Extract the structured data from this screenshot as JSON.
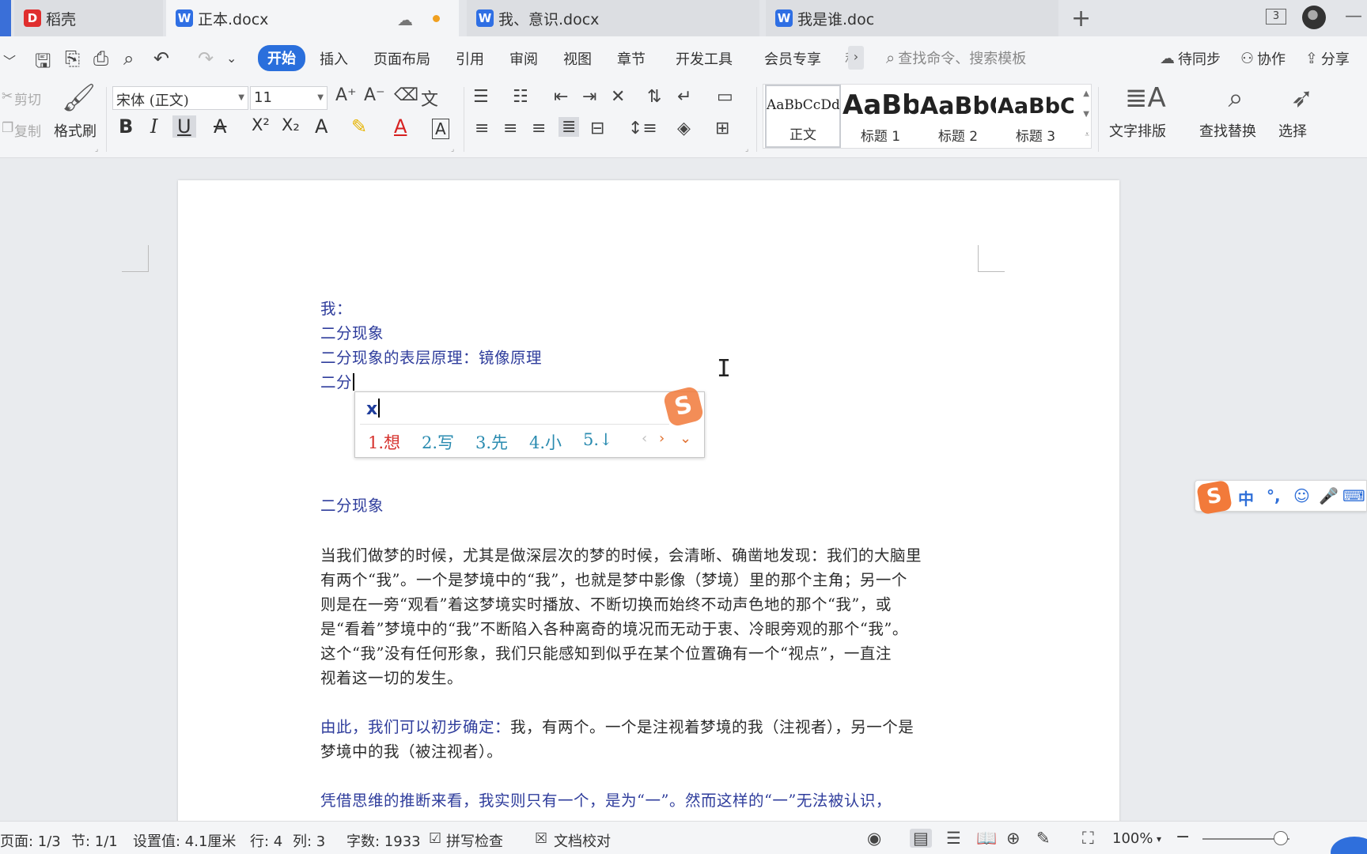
{
  "tabs": [
    {
      "label": "稻壳",
      "icon": "docer-icon",
      "active": false
    },
    {
      "label": "正本.docx",
      "icon": "word-doc-icon",
      "active": true,
      "unsaved": true
    },
    {
      "label": "我、意识.docx",
      "icon": "word-doc-icon",
      "active": false
    },
    {
      "label": "我是谁.doc",
      "icon": "word-doc-icon",
      "active": false
    }
  ],
  "window": {
    "count": "3"
  },
  "menu": {
    "items": [
      "开始",
      "插入",
      "页面布局",
      "引用",
      "审阅",
      "视图",
      "章节",
      "开发工具",
      "会员专享",
      "私"
    ],
    "active": "开始",
    "search_placeholder": "查找命令、搜索模板",
    "sync": "待同步",
    "collab": "协作",
    "share": "分享"
  },
  "ribbon": {
    "cut": "剪切",
    "copy": "复制",
    "format_painter": "格式刷",
    "font_name": "宋体 (正文)",
    "font_size": "11",
    "styles": [
      {
        "preview": "AaBbCcDd",
        "name": "正文"
      },
      {
        "preview": "AaBb",
        "name": "标题 1"
      },
      {
        "preview": "AaBbC",
        "name": "标题 2"
      },
      {
        "preview": "AaBbCc",
        "name": "标题 3"
      }
    ],
    "text_layout": "文字排版",
    "find_replace": "查找替换",
    "select": "选择"
  },
  "document": {
    "lines": [
      {
        "text": "我：",
        "blue": true
      },
      {
        "text": "二分现象",
        "blue": true
      },
      {
        "text": "二分现象的表层原理：镜像原理",
        "blue": true
      },
      {
        "text": "二分",
        "blue": true
      },
      {
        "text": "二分现象",
        "blue": true
      },
      {
        "text": "当我们做梦的时候，尤其是做深层次的梦的时候，会清晰、确凿地发现：我们的大脑里",
        "blue": false
      },
      {
        "text": "有两个“我”。一个是梦境中的“我”，也就是梦中影像（梦境）里的那个主角；另一个",
        "blue": false
      },
      {
        "text": "则是在一旁“观看”着这梦境实时播放、不断切换而始终不动声色地的那个“我”，或",
        "blue": false
      },
      {
        "text": "是“看着”梦境中的“我”不断陷入各种离奇的境况而无动于衷、冷眼旁观的那个“我”。",
        "blue": false
      },
      {
        "text": "这个“我”没有任何形象，我们只能感知到似乎在某个位置确有一个“视点”，一直注",
        "blue": false
      },
      {
        "text": "视着这一切的发生。",
        "blue": false
      },
      {
        "text": "由此，我们可以初步确定：",
        "blue": true,
        "rest": "我，有两个。一个是注视着梦境的我（注视者），另一个是"
      },
      {
        "text": "梦境中的我（被注视者）。",
        "blue": false
      },
      {
        "text": "凭借思维的推断来看，我实则只有一个，是为“一”。然而这样的“一”无法被认识，",
        "blue": true
      }
    ]
  },
  "ime": {
    "input": "x",
    "candidates": [
      "1.想",
      "2.写",
      "3.先",
      "4.小",
      "5.↓"
    ],
    "bar_lang": "中",
    "bar_punct": "°,"
  },
  "status": {
    "page": "页面: 1/3",
    "section": "节: 1/1",
    "setting": "设置值: 4.1厘米",
    "row": "行: 4",
    "col": "列: 3",
    "wordcount": "字数: 1933",
    "spellcheck": "拼写检查",
    "proofread": "文档校对",
    "zoom": "100%"
  },
  "colors": {
    "accent": "#2a6fdc",
    "doc_blue": "#2f3d9c",
    "ime_red": "#d6312c",
    "ime_teal": "#2a8bb0"
  }
}
